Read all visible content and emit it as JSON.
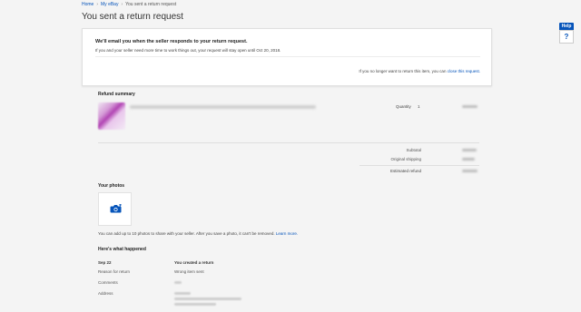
{
  "breadcrumb": {
    "items": [
      "Home",
      "My eBay",
      "You sent a return request"
    ],
    "separator": "›"
  },
  "page_title": "You sent a return request",
  "help": {
    "tab_label": "Help",
    "icon_glyph": "?"
  },
  "notice": {
    "heading": "We'll email you when the seller responds to your return request.",
    "body": "If you and your seller need more time to work things out, your request will stay open until Oct 20, 2018.",
    "close_prefix": "If you no longer want to return this item, you can",
    "close_link": "close this request."
  },
  "refund_summary": {
    "label": "Refund summary",
    "quantity_label": "Quantity",
    "quantity_value": "1",
    "subtotal_label": "Subtotal",
    "original_shipping_label": "Original shipping",
    "estimated_refund_label": "Estimated refund"
  },
  "photos": {
    "label": "Your photos",
    "camera_icon": "camera-add-icon",
    "note": "You can add up to 10 photos to share with your seller. After you save a photo, it can't be removed.",
    "learn_more": "Learn more."
  },
  "history": {
    "heading": "Here's what happened",
    "date": "Sep 22",
    "event": "You created a return",
    "reason_label": "Reason for return",
    "reason_value": "Wrong item sent",
    "comments_label": "Comments",
    "address_label": "Address"
  },
  "colors": {
    "link": "#0654ba",
    "background": "#f4f4f4",
    "card": "#ffffff",
    "help_tab": "#0654ba"
  }
}
